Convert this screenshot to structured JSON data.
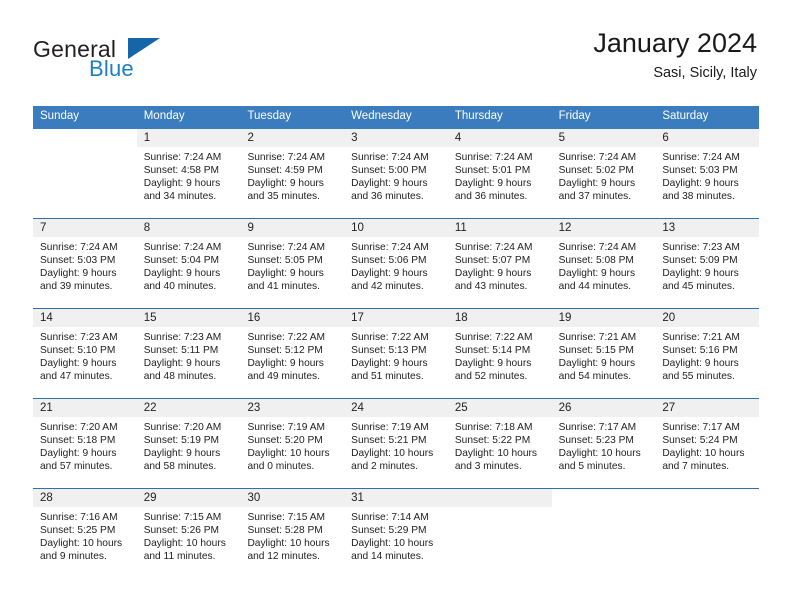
{
  "brand": {
    "name_part1": "General",
    "name_part2": "Blue",
    "accent_color": "#1c7fc4",
    "triangle_color": "#1565a8"
  },
  "header": {
    "title": "January 2024",
    "location": "Sasi, Sicily, Italy"
  },
  "calendar": {
    "header_color": "#3a7cbe",
    "weekdays": [
      "Sunday",
      "Monday",
      "Tuesday",
      "Wednesday",
      "Thursday",
      "Friday",
      "Saturday"
    ],
    "weeks": [
      [
        {
          "day": "",
          "blank": true
        },
        {
          "day": "1",
          "sunrise": "Sunrise: 7:24 AM",
          "sunset": "Sunset: 4:58 PM",
          "daylight_line1": "Daylight: 9 hours",
          "daylight_line2": "and 34 minutes."
        },
        {
          "day": "2",
          "sunrise": "Sunrise: 7:24 AM",
          "sunset": "Sunset: 4:59 PM",
          "daylight_line1": "Daylight: 9 hours",
          "daylight_line2": "and 35 minutes."
        },
        {
          "day": "3",
          "sunrise": "Sunrise: 7:24 AM",
          "sunset": "Sunset: 5:00 PM",
          "daylight_line1": "Daylight: 9 hours",
          "daylight_line2": "and 36 minutes."
        },
        {
          "day": "4",
          "sunrise": "Sunrise: 7:24 AM",
          "sunset": "Sunset: 5:01 PM",
          "daylight_line1": "Daylight: 9 hours",
          "daylight_line2": "and 36 minutes."
        },
        {
          "day": "5",
          "sunrise": "Sunrise: 7:24 AM",
          "sunset": "Sunset: 5:02 PM",
          "daylight_line1": "Daylight: 9 hours",
          "daylight_line2": "and 37 minutes."
        },
        {
          "day": "6",
          "sunrise": "Sunrise: 7:24 AM",
          "sunset": "Sunset: 5:03 PM",
          "daylight_line1": "Daylight: 9 hours",
          "daylight_line2": "and 38 minutes."
        }
      ],
      [
        {
          "day": "7",
          "sunrise": "Sunrise: 7:24 AM",
          "sunset": "Sunset: 5:03 PM",
          "daylight_line1": "Daylight: 9 hours",
          "daylight_line2": "and 39 minutes."
        },
        {
          "day": "8",
          "sunrise": "Sunrise: 7:24 AM",
          "sunset": "Sunset: 5:04 PM",
          "daylight_line1": "Daylight: 9 hours",
          "daylight_line2": "and 40 minutes."
        },
        {
          "day": "9",
          "sunrise": "Sunrise: 7:24 AM",
          "sunset": "Sunset: 5:05 PM",
          "daylight_line1": "Daylight: 9 hours",
          "daylight_line2": "and 41 minutes."
        },
        {
          "day": "10",
          "sunrise": "Sunrise: 7:24 AM",
          "sunset": "Sunset: 5:06 PM",
          "daylight_line1": "Daylight: 9 hours",
          "daylight_line2": "and 42 minutes."
        },
        {
          "day": "11",
          "sunrise": "Sunrise: 7:24 AM",
          "sunset": "Sunset: 5:07 PM",
          "daylight_line1": "Daylight: 9 hours",
          "daylight_line2": "and 43 minutes."
        },
        {
          "day": "12",
          "sunrise": "Sunrise: 7:24 AM",
          "sunset": "Sunset: 5:08 PM",
          "daylight_line1": "Daylight: 9 hours",
          "daylight_line2": "and 44 minutes."
        },
        {
          "day": "13",
          "sunrise": "Sunrise: 7:23 AM",
          "sunset": "Sunset: 5:09 PM",
          "daylight_line1": "Daylight: 9 hours",
          "daylight_line2": "and 45 minutes."
        }
      ],
      [
        {
          "day": "14",
          "sunrise": "Sunrise: 7:23 AM",
          "sunset": "Sunset: 5:10 PM",
          "daylight_line1": "Daylight: 9 hours",
          "daylight_line2": "and 47 minutes."
        },
        {
          "day": "15",
          "sunrise": "Sunrise: 7:23 AM",
          "sunset": "Sunset: 5:11 PM",
          "daylight_line1": "Daylight: 9 hours",
          "daylight_line2": "and 48 minutes."
        },
        {
          "day": "16",
          "sunrise": "Sunrise: 7:22 AM",
          "sunset": "Sunset: 5:12 PM",
          "daylight_line1": "Daylight: 9 hours",
          "daylight_line2": "and 49 minutes."
        },
        {
          "day": "17",
          "sunrise": "Sunrise: 7:22 AM",
          "sunset": "Sunset: 5:13 PM",
          "daylight_line1": "Daylight: 9 hours",
          "daylight_line2": "and 51 minutes."
        },
        {
          "day": "18",
          "sunrise": "Sunrise: 7:22 AM",
          "sunset": "Sunset: 5:14 PM",
          "daylight_line1": "Daylight: 9 hours",
          "daylight_line2": "and 52 minutes."
        },
        {
          "day": "19",
          "sunrise": "Sunrise: 7:21 AM",
          "sunset": "Sunset: 5:15 PM",
          "daylight_line1": "Daylight: 9 hours",
          "daylight_line2": "and 54 minutes."
        },
        {
          "day": "20",
          "sunrise": "Sunrise: 7:21 AM",
          "sunset": "Sunset: 5:16 PM",
          "daylight_line1": "Daylight: 9 hours",
          "daylight_line2": "and 55 minutes."
        }
      ],
      [
        {
          "day": "21",
          "sunrise": "Sunrise: 7:20 AM",
          "sunset": "Sunset: 5:18 PM",
          "daylight_line1": "Daylight: 9 hours",
          "daylight_line2": "and 57 minutes."
        },
        {
          "day": "22",
          "sunrise": "Sunrise: 7:20 AM",
          "sunset": "Sunset: 5:19 PM",
          "daylight_line1": "Daylight: 9 hours",
          "daylight_line2": "and 58 minutes."
        },
        {
          "day": "23",
          "sunrise": "Sunrise: 7:19 AM",
          "sunset": "Sunset: 5:20 PM",
          "daylight_line1": "Daylight: 10 hours",
          "daylight_line2": "and 0 minutes."
        },
        {
          "day": "24",
          "sunrise": "Sunrise: 7:19 AM",
          "sunset": "Sunset: 5:21 PM",
          "daylight_line1": "Daylight: 10 hours",
          "daylight_line2": "and 2 minutes."
        },
        {
          "day": "25",
          "sunrise": "Sunrise: 7:18 AM",
          "sunset": "Sunset: 5:22 PM",
          "daylight_line1": "Daylight: 10 hours",
          "daylight_line2": "and 3 minutes."
        },
        {
          "day": "26",
          "sunrise": "Sunrise: 7:17 AM",
          "sunset": "Sunset: 5:23 PM",
          "daylight_line1": "Daylight: 10 hours",
          "daylight_line2": "and 5 minutes."
        },
        {
          "day": "27",
          "sunrise": "Sunrise: 7:17 AM",
          "sunset": "Sunset: 5:24 PM",
          "daylight_line1": "Daylight: 10 hours",
          "daylight_line2": "and 7 minutes."
        }
      ],
      [
        {
          "day": "28",
          "sunrise": "Sunrise: 7:16 AM",
          "sunset": "Sunset: 5:25 PM",
          "daylight_line1": "Daylight: 10 hours",
          "daylight_line2": "and 9 minutes."
        },
        {
          "day": "29",
          "sunrise": "Sunrise: 7:15 AM",
          "sunset": "Sunset: 5:26 PM",
          "daylight_line1": "Daylight: 10 hours",
          "daylight_line2": "and 11 minutes."
        },
        {
          "day": "30",
          "sunrise": "Sunrise: 7:15 AM",
          "sunset": "Sunset: 5:28 PM",
          "daylight_line1": "Daylight: 10 hours",
          "daylight_line2": "and 12 minutes."
        },
        {
          "day": "31",
          "sunrise": "Sunrise: 7:14 AM",
          "sunset": "Sunset: 5:29 PM",
          "daylight_line1": "Daylight: 10 hours",
          "daylight_line2": "and 14 minutes."
        },
        {
          "day": "",
          "empty": true
        },
        {
          "day": "",
          "blank": true
        },
        {
          "day": "",
          "blank": true
        }
      ]
    ]
  }
}
